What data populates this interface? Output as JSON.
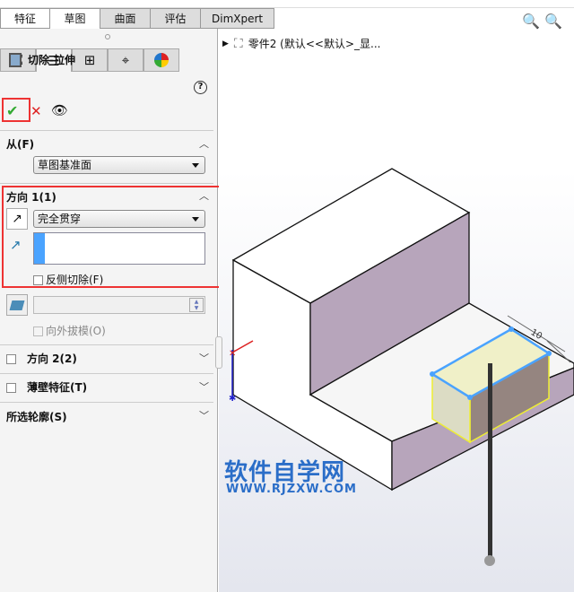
{
  "tabs": [
    "特征",
    "草图",
    "曲面",
    "评估",
    "DimXpert"
  ],
  "feature": {
    "title": "切除-拉伸",
    "help": "?",
    "ok": "✔",
    "cancel": "✕",
    "preview": "👁"
  },
  "from": {
    "header": "从(F)",
    "value": "草图基准面"
  },
  "direction1": {
    "header": "方向 1(1)",
    "end_condition": "完全贯穿",
    "flip_side": "反侧切除(F)",
    "draft_outward": "向外拔模(O)"
  },
  "direction2": {
    "header": "方向 2(2)"
  },
  "thin": {
    "header": "薄壁特征(T)"
  },
  "contours": {
    "header": "所选轮廓(S)"
  },
  "tree": {
    "part": "零件2  (默认<<默认>_显..."
  },
  "dimension": "10",
  "watermark": {
    "cn": "软件自学网",
    "url": "WWW.RJZXW.COM"
  }
}
